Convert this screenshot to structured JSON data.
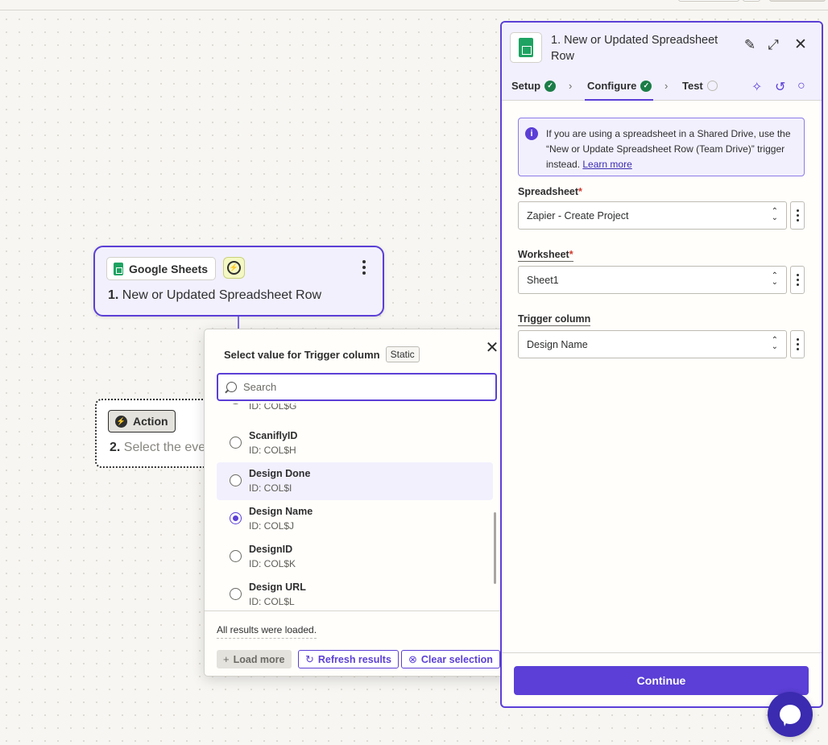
{
  "canvas": {
    "trigger_node": {
      "app_name": "Google Sheets",
      "step_number": "1.",
      "title": "New or Updated Spreadsheet Row"
    },
    "action_node": {
      "chip_label": "Action",
      "step_number": "2.",
      "title": "Select the eve"
    }
  },
  "popover": {
    "title": "Select value for Trigger column",
    "badge": "Static",
    "search_placeholder": "Search",
    "options": [
      {
        "label": "",
        "id": "ID: COL$G",
        "checked": false
      },
      {
        "label": "ScaniflyID",
        "id": "ID: COL$H",
        "checked": false
      },
      {
        "label": "Design Done",
        "id": "ID: COL$I",
        "checked": false
      },
      {
        "label": "Design Name",
        "id": "ID: COL$J",
        "checked": true
      },
      {
        "label": "DesignID",
        "id": "ID: COL$K",
        "checked": false
      },
      {
        "label": "Design URL",
        "id": "ID: COL$L",
        "checked": false
      }
    ],
    "footer_text": "All results were loaded.",
    "load_more": "Load more",
    "refresh": "Refresh results",
    "clear": "Clear selection"
  },
  "panel": {
    "step_number": "1.",
    "title": "New or Updated Spreadsheet Row",
    "tabs": {
      "setup": "Setup",
      "configure": "Configure",
      "test": "Test"
    },
    "notice": {
      "text": "If you are using a spreadsheet in a Shared Drive, use the “New or Update Spreadsheet Row (Team Drive)” trigger instead.",
      "link": "Learn more"
    },
    "fields": {
      "spreadsheet": {
        "label": "Spreadsheet",
        "required": "*",
        "value": "Zapier - Create Project"
      },
      "worksheet": {
        "label": "Worksheet",
        "required": "*",
        "value": "Sheet1"
      },
      "trigger_column": {
        "label": "Trigger column",
        "value": "Design Name"
      }
    },
    "continue_label": "Continue"
  },
  "colors": {
    "accent": "#5b3fd6",
    "success": "#1b7d47",
    "sheets_green": "#1ea362"
  }
}
